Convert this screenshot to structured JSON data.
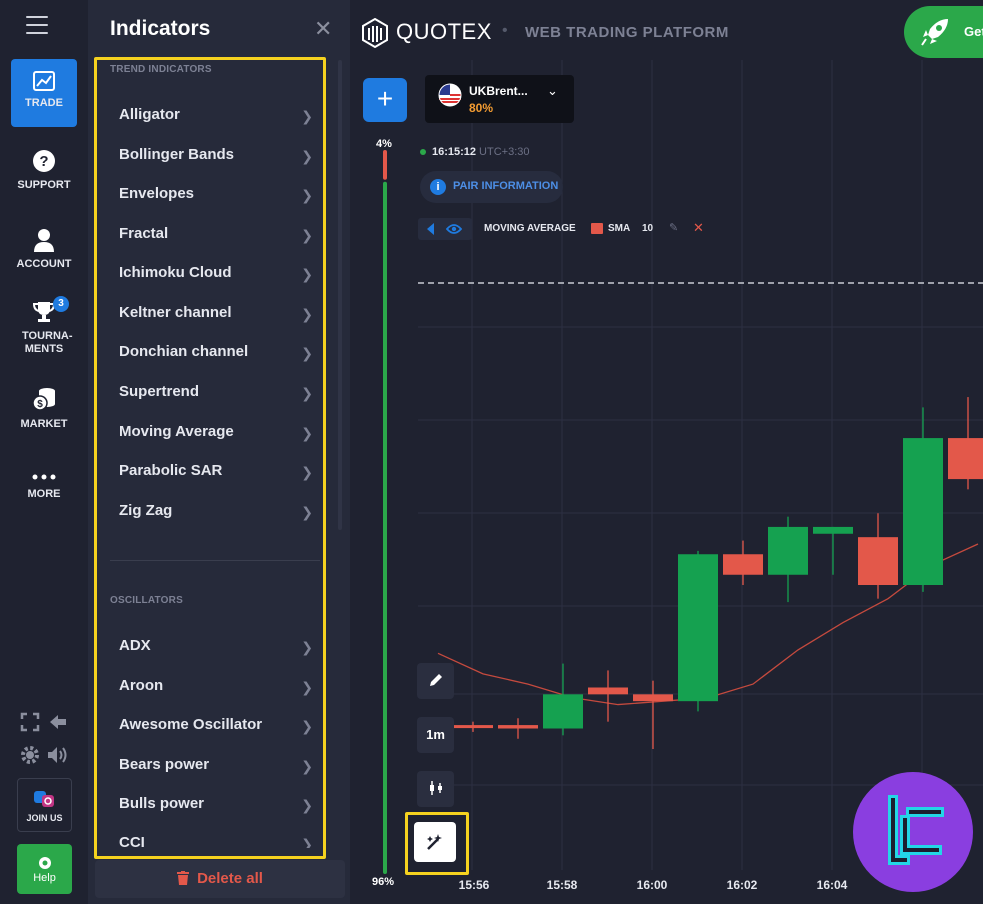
{
  "nav": {
    "items": [
      {
        "label": "TRADE",
        "icon": "chart-icon",
        "active": true
      },
      {
        "label": "SUPPORT",
        "icon": "question-icon"
      },
      {
        "label": "ACCOUNT",
        "icon": "user-icon"
      },
      {
        "label": "TOURNA-MENTS",
        "icon": "trophy-icon",
        "badge": "3"
      },
      {
        "label": "MARKET",
        "icon": "coins-icon"
      },
      {
        "label": "MORE",
        "icon": "dots-icon"
      }
    ],
    "join_label": "JOIN US",
    "help_label": "Help"
  },
  "panel": {
    "title": "Indicators",
    "trend_label": "TREND INDICATORS",
    "trend_items": [
      "Alligator",
      "Bollinger Bands",
      "Envelopes",
      "Fractal",
      "Ichimoku Cloud",
      "Keltner channel",
      "Donchian channel",
      "Supertrend",
      "Moving Average",
      "Parabolic SAR",
      "Zig Zag"
    ],
    "osc_label": "OSCILLATORS",
    "osc_items": [
      "ADX",
      "Aroon",
      "Awesome Oscillator",
      "Bears power",
      "Bulls power",
      "CCI"
    ],
    "delete_all": "Delete all"
  },
  "header": {
    "brand": "QUOTEX",
    "subtitle": "WEB TRADING PLATFORM",
    "get_label": "Get"
  },
  "asset": {
    "name": "UKBrent...",
    "payout": "80%"
  },
  "chart_info": {
    "time": "16:15:12",
    "timezone": "UTC+3:30",
    "pair_info": "PAIR INFORMATION",
    "indicator_name": "MOVING AVERAGE",
    "indicator_type": "SMA",
    "indicator_period": "10",
    "indicator_color": "#e3584a"
  },
  "sentiment": {
    "up": "4%",
    "down": "96%",
    "up_fraction": 0.04
  },
  "tools": {
    "timeframe": "1m"
  },
  "chart_data": {
    "type": "candlestick",
    "x": [
      "15:55",
      "15:56",
      "15:57",
      "15:58",
      "15:59",
      "16:00",
      "16:01",
      "16:02",
      "16:03",
      "16:04",
      "16:05",
      "16:06",
      "16:07"
    ],
    "tick_labels": [
      "15:56",
      "15:58",
      "16:00",
      "16:02",
      "16:04"
    ],
    "candles": [
      {
        "o": 59,
        "h": 60,
        "l": 57,
        "c": 59,
        "dir": "down"
      },
      {
        "o": 59,
        "h": 61,
        "l": 55,
        "c": 58,
        "dir": "down"
      },
      {
        "o": 58,
        "h": 77,
        "l": 56,
        "c": 68,
        "dir": "up"
      },
      {
        "o": 70,
        "h": 75,
        "l": 60,
        "c": 68,
        "dir": "down"
      },
      {
        "o": 68,
        "h": 72,
        "l": 52,
        "c": 66,
        "dir": "down"
      },
      {
        "o": 66,
        "h": 110,
        "l": 63,
        "c": 109,
        "dir": "up"
      },
      {
        "o": 109,
        "h": 113,
        "l": 100,
        "c": 103,
        "dir": "down"
      },
      {
        "o": 103,
        "h": 120,
        "l": 95,
        "c": 117,
        "dir": "up"
      },
      {
        "o": 117,
        "h": 117,
        "l": 103,
        "c": 115,
        "dir": "up"
      },
      {
        "o": 114,
        "h": 121,
        "l": 96,
        "c": 100,
        "dir": "down"
      },
      {
        "o": 100,
        "h": 152,
        "l": 98,
        "c": 143,
        "dir": "up"
      },
      {
        "o": 143,
        "h": 155,
        "l": 128,
        "c": 131,
        "dir": "down"
      },
      {
        "o": 126,
        "h": 148,
        "l": 97,
        "c": 103,
        "dir": "down"
      }
    ],
    "ma": [
      80,
      74,
      71,
      67,
      65,
      66,
      67,
      71,
      81,
      89,
      96,
      106,
      112
    ],
    "colors": {
      "up": "#15a150",
      "down": "#e3584a",
      "ma": "#c54a3e"
    }
  }
}
